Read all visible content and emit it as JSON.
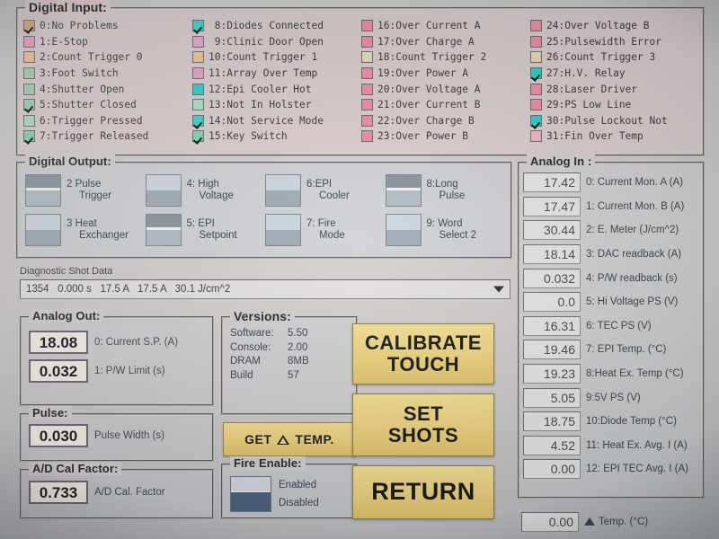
{
  "digital_input": {
    "title": "Digital Input:",
    "columns": [
      [
        {
          "label": "0:No Problems",
          "checked": true,
          "color": "#d9a97e"
        },
        {
          "label": "1:E-Stop",
          "checked": false,
          "color": "#e7a0bd"
        },
        {
          "label": "2:Count Trigger 0",
          "checked": false,
          "color": "#ecbf96"
        },
        {
          "label": "3:Foot Switch",
          "checked": false,
          "color": "#a6cfb5"
        },
        {
          "label": "4:Shutter Open",
          "checked": false,
          "color": "#a6cfb5"
        },
        {
          "label": "5:Shutter Closed",
          "checked": true,
          "color": "#a0cfb2"
        },
        {
          "label": "6:Trigger Pressed",
          "checked": false,
          "color": "#b2dcc3"
        },
        {
          "label": "7:Trigger Released",
          "checked": true,
          "color": "#88d4ae"
        }
      ],
      [
        {
          "label": " 8:Diodes Connected",
          "checked": true,
          "color": "#3fd4c8"
        },
        {
          "label": " 9:Clinic Door Open",
          "checked": false,
          "color": "#eaa8c4"
        },
        {
          "label": "10:Count Trigger 1",
          "checked": false,
          "color": "#edc69f"
        },
        {
          "label": "11:Array Over Temp",
          "checked": false,
          "color": "#e8a6c2"
        },
        {
          "label": "12:Epi Cooler Hot",
          "checked": false,
          "color": "#2fd2c6"
        },
        {
          "label": "13:Not In Holster",
          "checked": false,
          "color": "#a8e0cf"
        },
        {
          "label": "14:Not Service Mode",
          "checked": true,
          "color": "#3fd4c8"
        },
        {
          "label": "15:Key Switch",
          "checked": true,
          "color": "#7fd7b4"
        }
      ],
      [
        {
          "label": "16:Over Current A",
          "checked": false,
          "color": "#ec8fa6"
        },
        {
          "label": "17:Over Charge A",
          "checked": false,
          "color": "#ec8fa6"
        },
        {
          "label": "18:Count Trigger 2",
          "checked": false,
          "color": "#e6dcc0"
        },
        {
          "label": "19:Over Power A",
          "checked": false,
          "color": "#ec8fa6"
        },
        {
          "label": "20:Over Voltage A",
          "checked": false,
          "color": "#ec8fa6"
        },
        {
          "label": "21:Over Current B",
          "checked": false,
          "color": "#ec8fa6"
        },
        {
          "label": "22:Over Charge B",
          "checked": false,
          "color": "#ec8fa6"
        },
        {
          "label": "23:Over Power B",
          "checked": false,
          "color": "#ec8fa6"
        }
      ],
      [
        {
          "label": "24:Over Voltage B",
          "checked": false,
          "color": "#ec8fa6"
        },
        {
          "label": "25:Pulsewidth Error",
          "checked": false,
          "color": "#ec8fa6"
        },
        {
          "label": "26:Count Trigger 3",
          "checked": false,
          "color": "#e9d8b4"
        },
        {
          "label": "27:H.V. Relay",
          "checked": true,
          "color": "#2fd2c6"
        },
        {
          "label": "28:Laser Driver",
          "checked": false,
          "color": "#ec8fa6"
        },
        {
          "label": "29:PS Low Line",
          "checked": false,
          "color": "#ec8fa6"
        },
        {
          "label": "30:Pulse Lockout Not",
          "checked": true,
          "color": "#2fd2c6"
        },
        {
          "label": "31:Fin Over Temp",
          "checked": false,
          "color": "#eeb6cc"
        }
      ]
    ]
  },
  "digital_output": {
    "title": "Digital Output:",
    "items": [
      {
        "line1": "2 Pulse",
        "line2": "Trigger",
        "state": "down"
      },
      {
        "line1": "3 Heat",
        "line2": "Exchanger",
        "state": "up"
      },
      {
        "line1": "4: High",
        "line2": "Voltage",
        "state": "up"
      },
      {
        "line1": "5: EPI",
        "line2": "Setpoint",
        "state": "down"
      },
      {
        "line1": "6:EPI",
        "line2": "Cooler",
        "state": "up"
      },
      {
        "line1": "7: Fire",
        "line2": "Mode",
        "state": "up"
      },
      {
        "line1": "8:Long",
        "line2": "Pulse",
        "state": "down"
      },
      {
        "line1": "9: Word",
        "line2": "Select 2",
        "state": "up"
      }
    ]
  },
  "analog_in": {
    "title": "Analog In :",
    "rows": [
      {
        "value": "17.42",
        "label": "0: Current Mon. A (A)"
      },
      {
        "value": "17.47",
        "label": "1: Current Mon. B (A)"
      },
      {
        "value": "30.44",
        "label": "2: E. Meter (J/cm^2)"
      },
      {
        "value": "18.14",
        "label": "3: DAC readback (A)"
      },
      {
        "value": "0.032",
        "label": "4: P/W readback (s)"
      },
      {
        "value": "0.0",
        "label": "5: Hi Voltage PS (V)"
      },
      {
        "value": "16.31",
        "label": "6: TEC PS (V)"
      },
      {
        "value": "19.46",
        "label": "7: EPI Temp. (°C)"
      },
      {
        "value": "19.23",
        "label": "8:Heat Ex. Temp (°C)"
      },
      {
        "value": "5.05",
        "label": "9:5V PS (V)"
      },
      {
        "value": "18.75",
        "label": "10:Diode Temp  (°C)"
      },
      {
        "value": "4.52",
        "label": "11: Heat Ex. Avg. I (A)"
      },
      {
        "value": "0.00",
        "label": "12: EPI TEC Avg. I (A)"
      }
    ],
    "delta": {
      "value": "0.00",
      "label": "Temp. (°C)"
    }
  },
  "shot_data": {
    "caption": "Diagnostic Shot Data",
    "selected": "1354   0.000 s   17.5 A   17.5 A   30.1 J/cm^2"
  },
  "analog_out": {
    "title": "Analog Out:",
    "rows": [
      {
        "value": "18.08",
        "label": "0: Current S.P. (A)"
      },
      {
        "value": "0.032",
        "label": "1: P/W Limit (s)"
      }
    ]
  },
  "pulse": {
    "title": "Pulse:",
    "rows": [
      {
        "value": "0.030",
        "label": "Pulse Width (s)"
      }
    ]
  },
  "adcal": {
    "title": "A/D Cal Factor:",
    "rows": [
      {
        "value": "0.733",
        "label": "A/D Cal. Factor"
      }
    ]
  },
  "versions": {
    "title": "Versions:",
    "rows": [
      {
        "key": "Software:",
        "value": "5.50"
      },
      {
        "key": "Console:",
        "value": "2.00"
      },
      {
        "key": "DRAM",
        "value": "8MB"
      },
      {
        "key": "Build",
        "value": "57"
      }
    ]
  },
  "get_temp": {
    "label_pre": "GET",
    "label_post": "TEMP."
  },
  "fire_enable": {
    "title": "Fire Enable:",
    "option_top": "Enabled",
    "option_bottom": "Disabled"
  },
  "buttons": {
    "calibrate_l1": "CALIBRATE",
    "calibrate_l2": "TOUCH",
    "setshots_l1": "SET",
    "setshots_l2": "SHOTS",
    "return": "RETURN"
  },
  "colors": {
    "accent_yellow": "#eed484",
    "panel": "#d3d0ce",
    "input_panel": "#ddc9cb",
    "ok_green": "#a6cfb5",
    "fault_pink": "#ec8fa6",
    "active_cyan": "#2fd2c6"
  }
}
